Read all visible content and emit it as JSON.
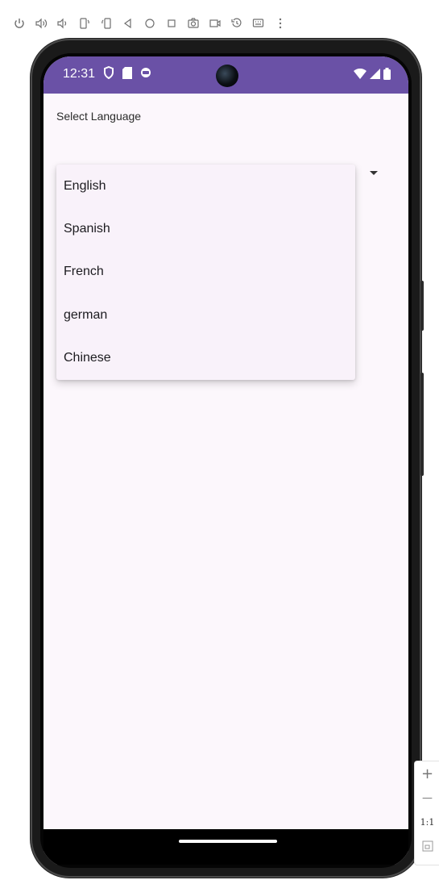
{
  "toolbar": {
    "buttons": [
      "power-icon",
      "volume-up-icon",
      "volume-down-icon",
      "rotate-left-icon",
      "rotate-right-icon",
      "back-icon",
      "home-icon",
      "overview-icon",
      "screenshot-icon",
      "screen-record-icon",
      "snapshot-icon",
      "keyboard-icon",
      "more-icon"
    ]
  },
  "status_bar": {
    "time": "12:31",
    "background": "#6a51a6"
  },
  "app": {
    "label": "Select Language",
    "menu_items": [
      "English",
      "Spanish",
      "French",
      "german",
      "Chinese"
    ]
  },
  "zoom": {
    "zoom_in": "+",
    "zoom_out": "—",
    "actual_size": "1:1"
  }
}
